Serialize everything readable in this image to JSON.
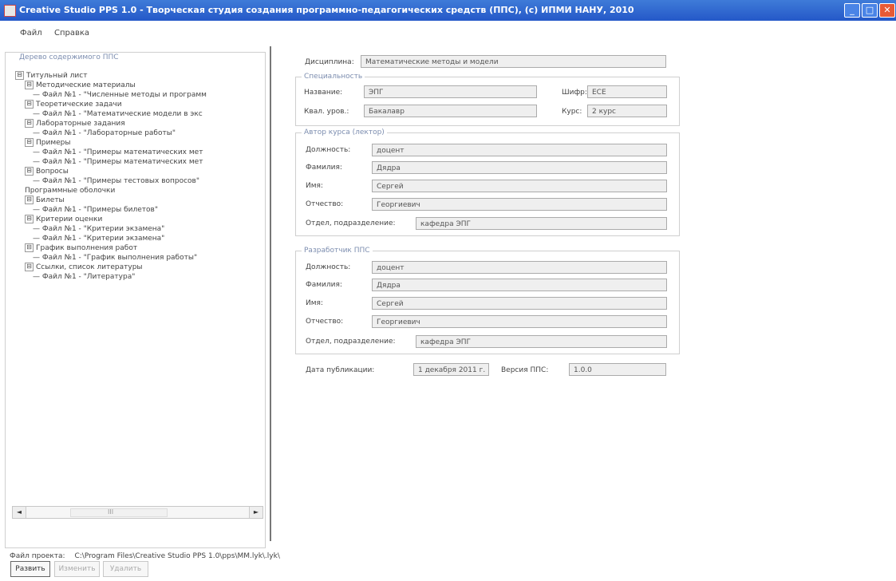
{
  "window": {
    "title": "Creative Studio PPS 1.0 - Творческая студия создания программно-педагогических средств (ППС), (c) ИПМИ НАНУ, 2010",
    "buttons": [
      "_",
      "□",
      "✕"
    ]
  },
  "menu": {
    "items": [
      "Файл",
      "Справка"
    ]
  },
  "tree_panel": {
    "title": "Дерево содержимого ППС",
    "items": [
      {
        "label": "Титульный лист",
        "expander": "⊟"
      },
      {
        "label": "Методические материалы",
        "expander": "⊟"
      },
      {
        "label": "— Файл №1 - \"Численные методы и программ",
        "expander": ""
      },
      {
        "label": "Теоретические задачи",
        "expander": "⊟"
      },
      {
        "label": "— Файл №1 - \"Математические модели в экс",
        "expander": ""
      },
      {
        "label": "Лабораторные задания",
        "expander": "⊟"
      },
      {
        "label": "— Файл №1 - \"Лабораторные работы\"",
        "expander": ""
      },
      {
        "label": "Примеры",
        "expander": "⊟"
      },
      {
        "label": "— Файл №1 - \"Примеры математических мет",
        "expander": ""
      },
      {
        "label": "— Файл №1 - \"Примеры математических мет",
        "expander": ""
      },
      {
        "label": "Вопросы",
        "expander": "⊟"
      },
      {
        "label": "— Файл №1 - \"Примеры тестовых вопросов\"",
        "expander": ""
      },
      {
        "label": "Программные оболочки",
        "expander": ""
      },
      {
        "label": "Билеты",
        "expander": "⊟"
      },
      {
        "label": "— Файл №1 - \"Примеры билетов\"",
        "expander": ""
      },
      {
        "label": "Критерии оценки",
        "expander": "⊟"
      },
      {
        "label": "— Файл №1 - \"Критерии экзамена\"",
        "expander": ""
      },
      {
        "label": "— Файл №1 - \"Критерии экзамена\"",
        "expander": ""
      },
      {
        "label": "График выполнения работ",
        "expander": "⊟"
      },
      {
        "label": "— Файл №1 - \"График выполнения работы\"",
        "expander": ""
      },
      {
        "label": "Ссылки, список литературы",
        "expander": "⊟"
      },
      {
        "label": "— Файл №1 - \"Литература\"",
        "expander": ""
      }
    ],
    "scroll": {
      "left": "◄",
      "center": "III",
      "right": "►"
    },
    "buttons": {
      "add": "Развить",
      "change": "Изменить",
      "delete": "Удалить"
    }
  },
  "form": {
    "discipline": {
      "label": "Дисциплина:",
      "value": "Математические методы и модели"
    },
    "speciality": {
      "legend": "Специальность",
      "name_label": "Название:",
      "name": "ЭПГ",
      "code_label": "Шифр:",
      "code": "ECE",
      "qual_label": "Квал. уров.:",
      "qual": "Бакалавр",
      "course_label": "Курс:",
      "course": "2 курс"
    },
    "author": {
      "legend": "Автор курса (лектор)",
      "post_label": "Должность:",
      "post": "доцент",
      "surname_label": "Фамилия:",
      "surname": "Дядра",
      "name_label": "Имя:",
      "name": "Сергей",
      "patronymic_label": "Отчество:",
      "patronymic": "Георгиевич",
      "department_label": "Отдел, подразделение:",
      "department": "кафедра ЭПГ"
    },
    "developer": {
      "legend": "Разработчик ППС",
      "post_label": "Должность:",
      "post": "доцент",
      "surname_label": "Фамилия:",
      "surname": "Дядра",
      "name_label": "Имя:",
      "name": "Сергей",
      "patronymic_label": "Отчество:",
      "patronymic": "Георгиевич",
      "department_label": "Отдел, подразделение:",
      "department": "кафедра ЭПГ"
    },
    "publication": {
      "date_label": "Дата публикации:",
      "date": "1 декабря 2011 г.",
      "version_label": "Версия ППС:",
      "version": "1.0.0"
    }
  },
  "status": {
    "label": "Файл проекта:",
    "path": "C:\\Program Files\\Creative Studio PPS 1.0\\pps\\MM.lyk\\.lyk\\"
  }
}
